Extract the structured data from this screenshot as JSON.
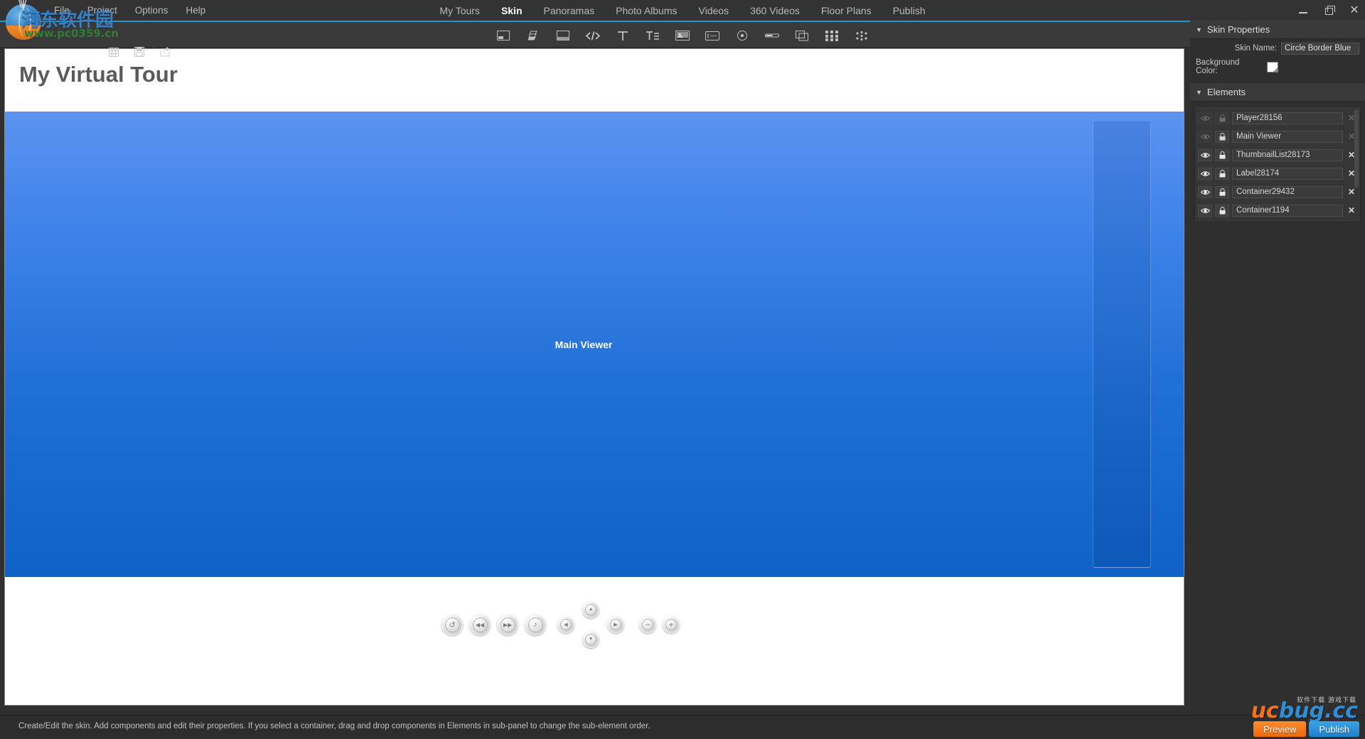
{
  "titlebar": {
    "left_menu": [
      {
        "label": "File",
        "name": "menu-file"
      },
      {
        "label": "Project",
        "name": "menu-project"
      },
      {
        "label": "Options",
        "name": "menu-options"
      },
      {
        "label": "Help",
        "name": "menu-help"
      }
    ],
    "center_tabs": [
      {
        "label": "My Tours",
        "active": false
      },
      {
        "label": "Skin",
        "active": true
      },
      {
        "label": "Panoramas",
        "active": false
      },
      {
        "label": "Photo Albums",
        "active": false
      },
      {
        "label": "Videos",
        "active": false
      },
      {
        "label": "360 Videos",
        "active": false
      },
      {
        "label": "Floor Plans",
        "active": false
      },
      {
        "label": "Publish",
        "active": false
      }
    ],
    "window_controls": {
      "minimize": "minimize-icon",
      "maximize": "restore-icon",
      "close": "✕"
    }
  },
  "watermark_logo": {
    "chinese_text": "河东软件园",
    "url_text": "www.pc0359.cn"
  },
  "toolbar": {
    "small_icons": [
      "grid-icon",
      "save-icon",
      "export-icon"
    ],
    "items": [
      {
        "name": "button-component-icon",
        "tooltip": "Button"
      },
      {
        "name": "hotspot-component-icon",
        "tooltip": "Hotspot"
      },
      {
        "name": "rectangle-component-icon",
        "tooltip": "Rectangle"
      },
      {
        "name": "html-code-component-icon",
        "tooltip": "HTML Code"
      },
      {
        "name": "text-component-icon",
        "tooltip": "Text"
      },
      {
        "name": "text-box-component-icon",
        "tooltip": "Text Box"
      },
      {
        "name": "image-component-icon",
        "tooltip": "Image"
      },
      {
        "name": "input-field-component-icon",
        "tooltip": "Input Field"
      },
      {
        "name": "radio-button-component-icon",
        "tooltip": "Radio Button"
      },
      {
        "name": "slider-component-icon",
        "tooltip": "Slider"
      },
      {
        "name": "container-component-icon",
        "tooltip": "Container"
      },
      {
        "name": "thumbnail-grid-component-icon",
        "tooltip": "Thumbnail Grid"
      },
      {
        "name": "more-components-icon",
        "tooltip": "More"
      }
    ]
  },
  "stage": {
    "tour_title": "My Virtual Tour",
    "viewer_label": "Main Viewer",
    "controls": [
      {
        "name": "reload-button",
        "glyph": "↺",
        "size": "lg"
      },
      {
        "name": "rewind-button",
        "glyph": "◀◀",
        "size": "lg"
      },
      {
        "name": "forward-button",
        "glyph": "▶▶",
        "size": "lg"
      },
      {
        "name": "mute-button",
        "glyph": "♪",
        "size": "lg"
      },
      {
        "name": "pan-left-button",
        "glyph": "◀",
        "size": "md"
      },
      {
        "name": "pan-up-button",
        "glyph": "▲",
        "size": "md"
      },
      {
        "name": "pan-down-button",
        "glyph": "▼",
        "size": "md"
      },
      {
        "name": "pan-right-button",
        "glyph": "▶",
        "size": "md"
      },
      {
        "name": "zoom-out-button",
        "glyph": "−",
        "size": "md"
      },
      {
        "name": "zoom-in-button",
        "glyph": "+",
        "size": "md"
      }
    ]
  },
  "right_panel": {
    "skin_properties": {
      "section_title": "Skin Properties",
      "caret": "▼",
      "skin_name_label": "Skin Name:",
      "skin_name_value": "Circle Border Blue",
      "background_color_label": "Background Color:",
      "background_color_value": "#ffffff"
    },
    "elements": {
      "section_title": "Elements",
      "caret": "▼",
      "rows": [
        {
          "name": "Player28156",
          "visible_enabled": false,
          "lock_enabled": false,
          "removable": false
        },
        {
          "name": "Main Viewer",
          "visible_enabled": false,
          "lock_enabled": true,
          "removable": false
        },
        {
          "name": "ThumbnailList28173",
          "visible_enabled": true,
          "lock_enabled": true,
          "removable": true
        },
        {
          "name": "Label28174",
          "visible_enabled": true,
          "lock_enabled": true,
          "removable": true
        },
        {
          "name": "Container29432",
          "visible_enabled": true,
          "lock_enabled": true,
          "removable": true
        },
        {
          "name": "Container1194",
          "visible_enabled": true,
          "lock_enabled": true,
          "removable": true
        }
      ],
      "eye_glyph": "◉",
      "lock_glyph": "□",
      "remove_glyph": "✕"
    }
  },
  "statusbar": {
    "text": "Create/Edit the skin. Add components and edit their properties. If you select a container, drag and drop components in Elements in sub-panel to change the sub-element order.",
    "preview_button": "Preview",
    "publish_button": "Publish"
  },
  "brand": {
    "top_text": "软件下载 游戏下载",
    "uc": "uc",
    "bug": "bug",
    "tld": ".cc"
  },
  "colors": {
    "accent_blue": "#2196c9",
    "panel_bg": "#2f2f2f",
    "titlebar_bg": "#333333",
    "toolbar_bg": "#3a3a3a",
    "viewer_top": "#5b93f0",
    "viewer_bottom": "#0f62c8",
    "preview_orange": "#ed6a10",
    "publish_blue": "#1c82cd"
  }
}
